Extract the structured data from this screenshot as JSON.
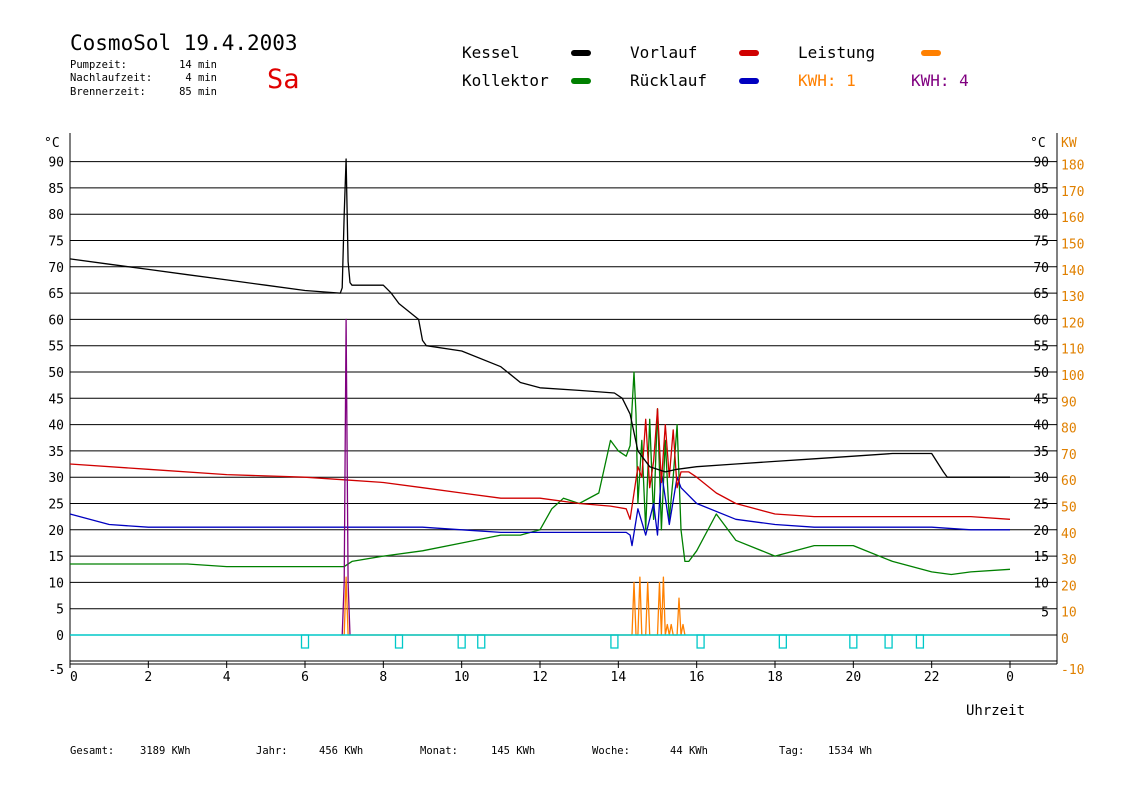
{
  "header": {
    "title": "CosmoSol 19.4.2003",
    "day": "Sa",
    "info": [
      {
        "label": "Pumpzeit:",
        "value": "14 min"
      },
      {
        "label": "Nachlaufzeit:",
        "value": "4 min"
      },
      {
        "label": "Brennerzeit:",
        "value": "85 min"
      }
    ]
  },
  "legend": {
    "kessel": "Kessel",
    "kollektor": "Kollektor",
    "vorlauf": "Vorlauf",
    "ruecklauf": "Rücklauf",
    "leistung": "Leistung",
    "kwh1": "KWH: 1",
    "kwh4": "KWH: 4"
  },
  "footer": [
    {
      "label": "Gesamt:",
      "value": "3189 KWh"
    },
    {
      "label": "Jahr:",
      "value": "456 KWh"
    },
    {
      "label": "Monat:",
      "value": "145 KWh"
    },
    {
      "label": "Woche:",
      "value": "44 KWh"
    },
    {
      "label": "Tag:",
      "value": "1534 Wh"
    }
  ],
  "colors": {
    "kessel": "#000000",
    "kollektor": "#008000",
    "vorlauf": "#d00000",
    "ruecklauf": "#0000c0",
    "leistung": "#ff8000",
    "kwh4": "#800080",
    "pump": "#00c8c8",
    "kw_axis": "#e08000"
  },
  "chart_data": {
    "type": "line",
    "xlabel": "Uhrzeit",
    "ylabel": "°C",
    "y2label": "KW",
    "xlim": [
      0,
      24
    ],
    "ylim": [
      -5,
      95
    ],
    "y2lim": [
      -10,
      190
    ],
    "x_ticks": [
      "0",
      "2",
      "4",
      "6",
      "8",
      "10",
      "12",
      "14",
      "16",
      "18",
      "20",
      "22",
      "0"
    ],
    "y_ticks": [
      "-5",
      "0",
      "5",
      "10",
      "15",
      "20",
      "25",
      "30",
      "35",
      "40",
      "45",
      "50",
      "55",
      "60",
      "65",
      "70",
      "75",
      "80",
      "85",
      "90"
    ],
    "y_ticks_right": [
      "5",
      "10",
      "15",
      "20",
      "25",
      "30",
      "35",
      "40",
      "45",
      "50",
      "55",
      "60",
      "65",
      "70",
      "75",
      "80",
      "85",
      "90"
    ],
    "y2_ticks": [
      "-10",
      "0",
      "10",
      "20",
      "30",
      "40",
      "50",
      "60",
      "70",
      "80",
      "90",
      "100",
      "110",
      "120",
      "130",
      "140",
      "150",
      "160",
      "170",
      "180"
    ],
    "grid": true,
    "series": [
      {
        "name": "Kessel",
        "key": "kessel",
        "x": [
          0,
          1,
          2,
          3,
          4,
          5,
          6,
          6.9,
          6.95,
          7.0,
          7.05,
          7.1,
          7.15,
          7.2,
          8.0,
          8.2,
          8.4,
          8.9,
          9.0,
          9.1,
          10,
          11,
          11.5,
          12,
          13,
          13.9,
          14.1,
          14.3,
          14.5,
          14.8,
          15.2,
          15.5,
          16,
          17,
          18,
          19,
          20,
          21,
          21.7,
          22.0,
          22.3,
          22.4,
          24
        ],
        "y": [
          71.5,
          70.5,
          69.5,
          68.5,
          67.5,
          66.5,
          65.5,
          65,
          66,
          80,
          90.5,
          71,
          67,
          66.5,
          66.5,
          65,
          63,
          60,
          56,
          55,
          54,
          51,
          48,
          47,
          46.5,
          46,
          45,
          42,
          35,
          32,
          31,
          31.5,
          32,
          32.5,
          33,
          33.5,
          34,
          34.5,
          34.5,
          34.5,
          31,
          30,
          30
        ]
      },
      {
        "name": "Kollektor",
        "key": "kollektor",
        "x": [
          0,
          1,
          2,
          3,
          4,
          5,
          6,
          7.0,
          7.2,
          8,
          9,
          10,
          11,
          11.5,
          12,
          12.3,
          12.6,
          13,
          13.5,
          13.8,
          14.0,
          14.2,
          14.3,
          14.35,
          14.4,
          14.45,
          14.5,
          14.6,
          14.7,
          14.8,
          14.9,
          15.0,
          15.1,
          15.2,
          15.3,
          15.4,
          15.5,
          15.6,
          15.7,
          15.8,
          16.0,
          16.5,
          17,
          18,
          19,
          20,
          21,
          22,
          22.5,
          23,
          24
        ],
        "y": [
          13.5,
          13.5,
          13.5,
          13.5,
          13,
          13,
          13,
          13,
          14,
          15,
          16,
          17.5,
          19,
          19,
          20,
          24,
          26,
          25,
          27,
          37,
          35,
          34,
          36,
          43,
          50,
          42,
          25,
          37,
          20,
          41,
          22,
          43,
          20,
          37,
          22,
          30,
          40,
          20,
          14,
          14,
          16,
          23,
          18,
          15,
          17,
          17,
          14,
          12,
          11.5,
          12,
          12.5
        ]
      },
      {
        "name": "Vorlauf",
        "key": "vorlauf",
        "x": [
          0,
          2,
          4,
          6,
          7,
          8,
          9,
          10,
          11,
          12,
          13,
          13.8,
          14.2,
          14.3,
          14.5,
          14.6,
          14.7,
          14.8,
          14.9,
          15.0,
          15.1,
          15.2,
          15.3,
          15.4,
          15.5,
          15.6,
          15.8,
          16,
          16.5,
          17,
          18,
          19,
          20,
          21,
          22,
          23,
          24
        ],
        "y": [
          32.5,
          31.5,
          30.5,
          30,
          29.5,
          29,
          28,
          27,
          26,
          26,
          25,
          24.5,
          24,
          22,
          32,
          30,
          41,
          28,
          33,
          43,
          29,
          40,
          30,
          39,
          28,
          31,
          31,
          30,
          27,
          25,
          23,
          22.5,
          22.5,
          22.5,
          22.5,
          22.5,
          22
        ]
      },
      {
        "name": "Rücklauf",
        "key": "ruecklauf",
        "x": [
          0,
          1,
          2,
          3,
          4,
          5,
          6,
          7,
          8,
          9,
          10,
          11,
          12,
          13,
          14,
          14.2,
          14.3,
          14.35,
          14.5,
          14.7,
          14.9,
          15.0,
          15.1,
          15.3,
          15.5,
          15.6,
          16,
          17,
          18,
          19,
          20,
          21,
          22,
          23,
          24
        ],
        "y": [
          23,
          21,
          20.5,
          20.5,
          20.5,
          20.5,
          20.5,
          20.5,
          20.5,
          20.5,
          20,
          19.5,
          19.5,
          19.5,
          19.5,
          19.5,
          19,
          17,
          24,
          19,
          25,
          19,
          31,
          21,
          30,
          28,
          25,
          22,
          21,
          20.5,
          20.5,
          20.5,
          20.5,
          20,
          20
        ]
      },
      {
        "name": "Leistung",
        "key": "leistung",
        "x": [
          6.9,
          7.0,
          7.05,
          7.1,
          7.2,
          14.3,
          14.35,
          14.4,
          14.45,
          14.5,
          14.55,
          14.6,
          14.65,
          14.7,
          14.75,
          14.8,
          14.9,
          15.0,
          15.05,
          15.1,
          15.15,
          15.2,
          15.25,
          15.3,
          15.35,
          15.4,
          15.5,
          15.55,
          15.6,
          15.65,
          15.7
        ],
        "y": [
          0,
          0,
          11,
          0,
          0,
          0,
          0,
          10,
          0,
          0,
          11,
          0,
          0,
          0,
          10,
          0,
          0,
          0,
          10,
          0,
          11,
          0,
          2,
          0,
          2,
          0,
          0,
          7,
          0,
          2,
          0
        ]
      },
      {
        "name": "KWH: 4",
        "key": "kwh4",
        "x": [
          6.95,
          7.0,
          7.05,
          7.1,
          7.15
        ],
        "y": [
          0,
          10,
          60,
          10,
          0
        ]
      }
    ],
    "pump_markers": [
      6.0,
      8.4,
      10.0,
      10.5,
      13.9,
      16.1,
      18.2,
      20.0,
      20.9,
      21.7
    ]
  }
}
